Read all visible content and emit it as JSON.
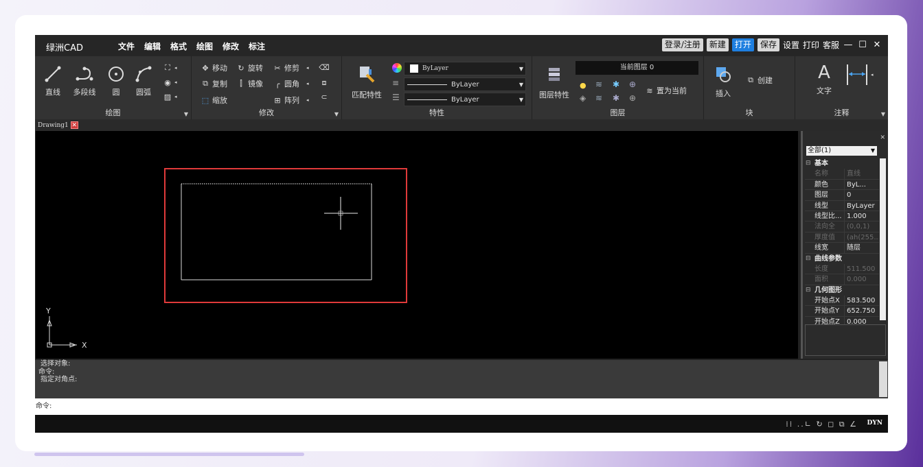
{
  "app": {
    "title": "绿洲CAD"
  },
  "menu": [
    "文件",
    "编辑",
    "格式",
    "绘图",
    "修改",
    "标注"
  ],
  "titlebar": {
    "login": "登录/注册",
    "new": "新建",
    "open": "打开",
    "save": "保存",
    "settings": "设置",
    "print": "打印",
    "service": "客服"
  },
  "ribbon": {
    "draw": {
      "title": "绘图",
      "line": "直线",
      "polyline": "多段线",
      "circle": "圆",
      "arc": "圆弧"
    },
    "modify": {
      "title": "修改",
      "move": "移动",
      "rotate": "旋转",
      "trim": "修剪",
      "copy": "复制",
      "mirror": "镜像",
      "fillet": "圆角",
      "scale": "缩放",
      "array": "阵列"
    },
    "properties": {
      "title": "特性",
      "match": "匹配特性",
      "color": "ByLayer",
      "linetype": "ByLayer",
      "lineweight": "ByLayer"
    },
    "layers": {
      "title": "图层",
      "layer_props": "图层特性",
      "current_layer": "当前图层  0",
      "set_current": "置为当前"
    },
    "block": {
      "title": "块",
      "insert": "插入",
      "create": "创建"
    },
    "annotation": {
      "title": "注释",
      "text": "文字"
    }
  },
  "tabs": [
    {
      "label": "Drawing1"
    }
  ],
  "canvas": {
    "ucs_y": "Y",
    "ucs_x": "X",
    "highlight_color": "#e03a3a"
  },
  "properties_panel": {
    "filter": "全部(1)",
    "sections": [
      {
        "title": "基本",
        "rows": [
          {
            "key": "名称",
            "value": "直线",
            "dim": true
          },
          {
            "key": "颜色",
            "value": "ByL..."
          },
          {
            "key": "图层",
            "value": "0"
          },
          {
            "key": "线型",
            "value": "ByLayer"
          },
          {
            "key": "线型比...",
            "value": "1.000"
          },
          {
            "key": "法向全",
            "value": "(0,0,1)",
            "dim": true
          },
          {
            "key": "厚度值",
            "value": "(ah(255...",
            "dim": true
          },
          {
            "key": "线宽",
            "value": "随层"
          }
        ]
      },
      {
        "title": "曲线参数",
        "rows": [
          {
            "key": "长度",
            "value": "511.500",
            "dim": true
          },
          {
            "key": "面积",
            "value": "0.000",
            "dim": true
          }
        ]
      },
      {
        "title": "几何图形",
        "rows": [
          {
            "key": "开始点X",
            "value": "583.500"
          },
          {
            "key": "开始点Y",
            "value": "652.750"
          },
          {
            "key": "开始点Z",
            "value": "0.000"
          }
        ]
      }
    ]
  },
  "command_history": [
    "选择对象:",
    "命令:",
    "指定对角点:"
  ],
  "command_input": "命令:",
  "status_bar": {
    "dyn": "DYN"
  }
}
